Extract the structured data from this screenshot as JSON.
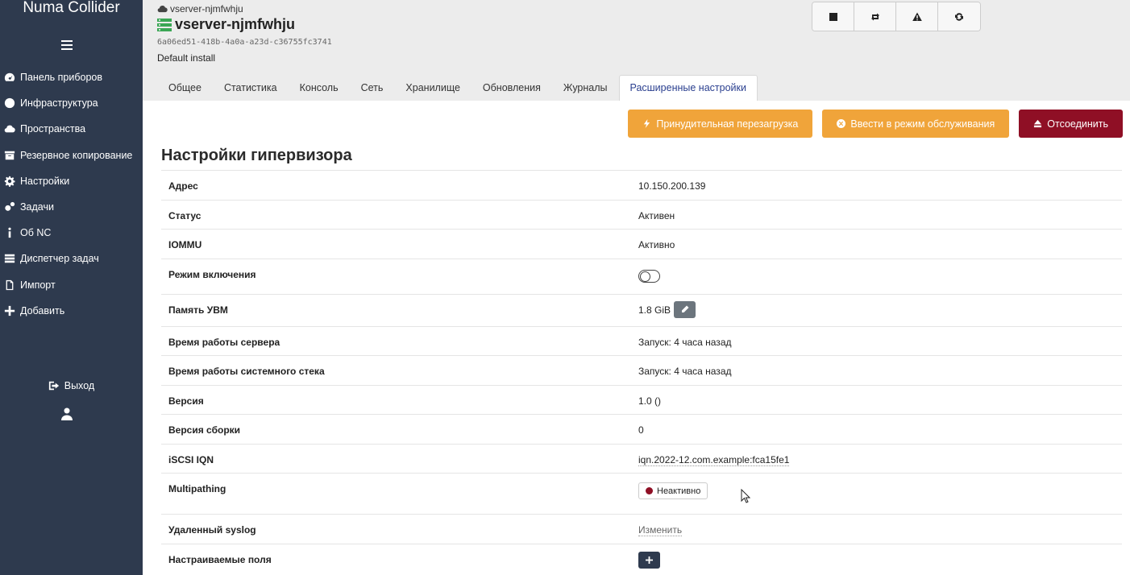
{
  "app": {
    "brand": "Numa Collider"
  },
  "sidebar": {
    "items": [
      {
        "label": "Панель приборов",
        "icon": "dashboard-icon"
      },
      {
        "label": "Инфраструктура",
        "icon": "globe-icon"
      },
      {
        "label": "Пространства",
        "icon": "cloud-icon"
      },
      {
        "label": "Резервное копирование",
        "icon": "archive-icon"
      },
      {
        "label": "Настройки",
        "icon": "gear-icon"
      },
      {
        "label": "Задачи",
        "icon": "gears-icon"
      },
      {
        "label": "Об NC",
        "icon": "info-icon"
      },
      {
        "label": "Диспетчер задач",
        "icon": "tasks-icon"
      },
      {
        "label": "Импорт",
        "icon": "import-icon"
      },
      {
        "label": "Добавить",
        "icon": "plus-icon"
      }
    ],
    "logout_label": "Выход"
  },
  "header": {
    "breadcrumb": "vserver-njmfwhju",
    "title": "vserver-njmfwhju",
    "uuid": "6a06ed51-418b-4a0a-a23d-c36755fc3741",
    "description": "Default install"
  },
  "tabs": [
    {
      "label": "Общее"
    },
    {
      "label": "Статистика"
    },
    {
      "label": "Консоль"
    },
    {
      "label": "Сеть"
    },
    {
      "label": "Хранилище"
    },
    {
      "label": "Обновления"
    },
    {
      "label": "Журналы"
    },
    {
      "label": "Расширенные настройки",
      "active": true
    }
  ],
  "actions": {
    "force_reboot": "Принудительная перезагрузка",
    "maintenance": "Ввести в режим обслуживания",
    "detach": "Отсоединить"
  },
  "section": {
    "title": "Настройки гипервизора",
    "rows": {
      "address": {
        "key": "Адрес",
        "value": "10.150.200.139"
      },
      "status": {
        "key": "Статус",
        "value": "Активен"
      },
      "iommu": {
        "key": "IOMMU",
        "value": "Активно"
      },
      "power_mode": {
        "key": "Режим включения"
      },
      "memory": {
        "key": "Память УВМ",
        "value": "1.8 GiB"
      },
      "server_uptime": {
        "key": "Время работы сервера",
        "value": "Запуск: 4 часа назад"
      },
      "stack_uptime": {
        "key": "Время работы системного стека",
        "value": "Запуск: 4 часа назад"
      },
      "version": {
        "key": "Версия",
        "value": "1.0 ()"
      },
      "build": {
        "key": "Версия сборки",
        "value": "0"
      },
      "iscsi": {
        "key": "iSCSI IQN",
        "value": "iqn.2022-12.com.example:fca15fe1"
      },
      "multipathing": {
        "key": "Multipathing",
        "value": "Неактивно"
      },
      "syslog": {
        "key": "Удаленный syslog",
        "value": "Изменить"
      },
      "custom_fields": {
        "key": "Настраиваемые поля"
      }
    }
  },
  "colors": {
    "sidebar_bg": "#2e3a4e",
    "orange": "#f0a43a",
    "danger": "#8f0f25",
    "active_tab_text": "#2a3f8f",
    "server_green": "#3aa655"
  }
}
